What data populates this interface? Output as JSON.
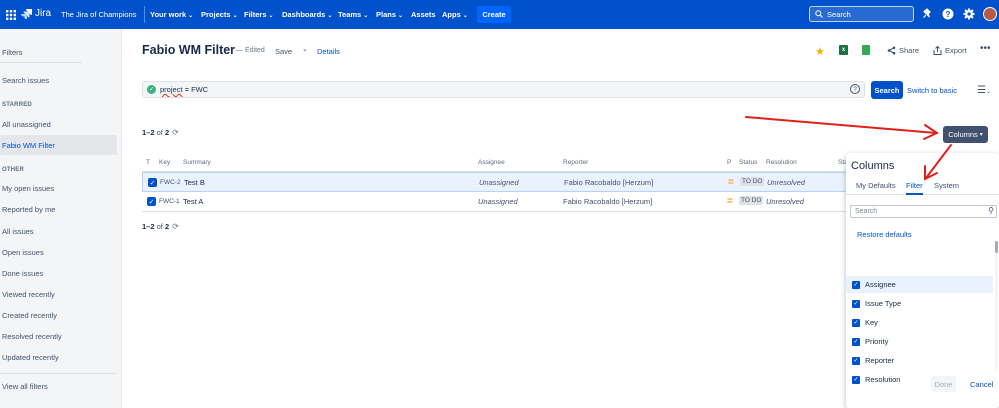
{
  "topnav": {
    "product": "Jira",
    "site": "The Jira of Champions",
    "items": [
      {
        "label": "Your work",
        "chevron": true
      },
      {
        "label": "Projects",
        "chevron": true
      },
      {
        "label": "Filters",
        "chevron": true
      },
      {
        "label": "Dashboards",
        "chevron": true
      },
      {
        "label": "Teams",
        "chevron": true
      },
      {
        "label": "Plans",
        "chevron": true
      },
      {
        "label": "Assets",
        "chevron": false
      },
      {
        "label": "Apps",
        "chevron": true
      }
    ],
    "create_label": "Create",
    "search_placeholder": "Search",
    "icons": [
      "app-switcher-icon",
      "notifications-icon",
      "help-icon",
      "settings-icon",
      "avatar"
    ],
    "brand_color": "#0052cc"
  },
  "sidebar": {
    "title": "Filters",
    "search_issues": "Search issues",
    "starred_heading": "STARRED",
    "starred": [
      "All unassigned",
      "Fabio WM Filter"
    ],
    "selected": "Fabio WM Filter",
    "other_heading": "OTHER",
    "other": [
      "My open issues",
      "Reported by me",
      "All issues",
      "Open issues",
      "Done issues",
      "Viewed recently",
      "Created recently",
      "Resolved recently",
      "Updated recently"
    ],
    "view_all": "View all filters"
  },
  "header": {
    "title": "Fabio WM Filter",
    "edited": "Edited",
    "save": "Save",
    "details": "Details",
    "share": "Share",
    "export": "Export",
    "more": "•••"
  },
  "query": {
    "field": "project",
    "rest": " = FWC",
    "search_button": "Search",
    "switch_label": "Switch to basic"
  },
  "results": {
    "count_range": "1–2",
    "count_of": " of ",
    "count_total": "2"
  },
  "columns_button": "Columns",
  "table": {
    "headers": [
      "T",
      "Key",
      "Summary",
      "Assignee",
      "Reporter",
      "P",
      "Status",
      "Resolution",
      "Sta"
    ],
    "rows": [
      {
        "key": "FWC-2",
        "summary": "Test B",
        "assignee": "Unassigned",
        "reporter": "Fabio Racobaldo [Herzum]",
        "priority": "=",
        "status": "TO DO",
        "resolution": "Unresolved",
        "selected": true
      },
      {
        "key": "FWC-1",
        "summary": "Test A",
        "assignee": "Unassigned",
        "reporter": "Fabio Racobaldo [Herzum]",
        "priority": "=",
        "status": "TO DO",
        "resolution": "Unresolved",
        "selected": false
      }
    ]
  },
  "columns_panel": {
    "title": "Columns",
    "tabs": [
      "My Defaults",
      "Filter",
      "System"
    ],
    "active_tab": "Filter",
    "search_placeholder": "Search",
    "restore": "Restore defaults",
    "options": [
      "Assignee",
      "Issue Type",
      "Key",
      "Priority",
      "Reporter",
      "Resolution"
    ],
    "done": "Done",
    "cancel": "Cancel"
  },
  "annotation_color": "#e0201b"
}
